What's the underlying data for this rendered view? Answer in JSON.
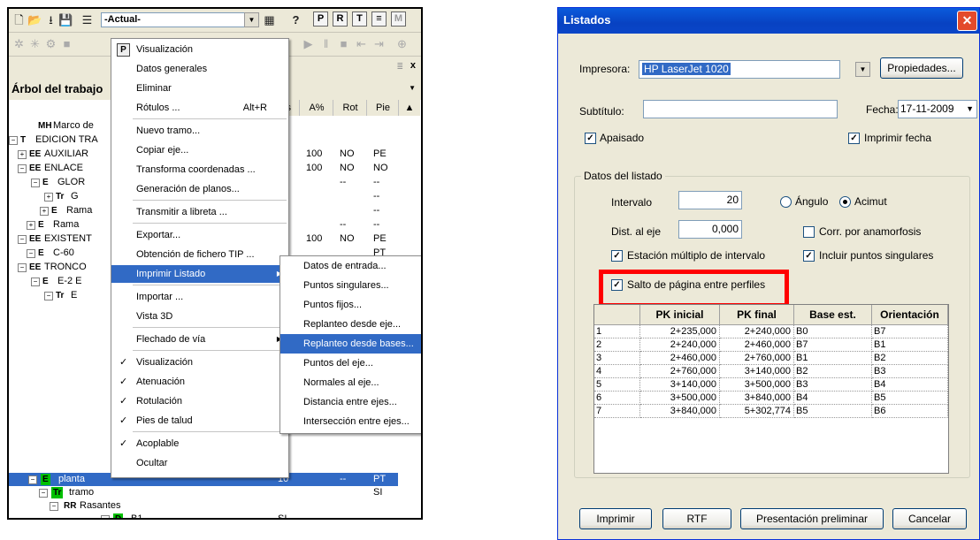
{
  "left": {
    "toolbar": {
      "view_combo": "-Actual-"
    },
    "tree_header": {
      "title": "Árbol del trabajo"
    },
    "columns": [
      "A%",
      "Rot",
      "Pie"
    ],
    "tree_rows": [
      {
        "code": "MH",
        "label": "Marco de",
        "a": "",
        "rot": "",
        "pie": ""
      },
      {
        "code": "T",
        "label": "EDICION TRA",
        "a": "",
        "rot": "",
        "pie": ""
      },
      {
        "code": "EE",
        "label": "AUXILIAR",
        "a": "100",
        "rot": "NO",
        "pie": "PE"
      },
      {
        "code": "EE",
        "label": "ENLACE",
        "a": "100",
        "rot": "NO",
        "pie": "NO"
      },
      {
        "code": "E",
        "label": "GLOR",
        "a": "",
        "rot": "--",
        "pie": "--"
      },
      {
        "code": "Tr",
        "label": "G",
        "a": "",
        "rot": "",
        "pie": "--"
      },
      {
        "code": "E",
        "label": "Rama",
        "a": "",
        "rot": "",
        "pie": "--"
      },
      {
        "code": "E",
        "label": "Rama",
        "a": "",
        "rot": "--",
        "pie": "--"
      },
      {
        "code": "EE",
        "label": "EXISTENT",
        "a": "100",
        "rot": "NO",
        "pie": "PE"
      },
      {
        "code": "E",
        "label": "C-60",
        "a": "",
        "rot": "",
        "pie": "PT"
      },
      {
        "code": "EE",
        "label": "TRONCO",
        "a": "",
        "rot": "",
        "pie": ""
      },
      {
        "code": "E",
        "label": "E-2 E",
        "a": "",
        "rot": "",
        "pie": ""
      },
      {
        "code": "Tr",
        "label": "E",
        "a": "",
        "rot": "",
        "pie": ""
      }
    ],
    "menu": [
      {
        "label": "Visualización",
        "icon": "P"
      },
      {
        "label": "Datos generales"
      },
      {
        "label": "Eliminar"
      },
      {
        "label": "Rótulos ...",
        "shortcut": "Alt+R"
      },
      {
        "label": "Nuevo tramo..."
      },
      {
        "label": "Copiar eje..."
      },
      {
        "label": "Transforma coordenadas ..."
      },
      {
        "label": "Generación de planos..."
      },
      {
        "label": "Transmitir a libreta ..."
      },
      {
        "label": "Exportar..."
      },
      {
        "label": "Obtención de fichero TIP ..."
      },
      {
        "label": "Imprimir Listado",
        "submenu": true,
        "highlighted": true
      },
      {
        "label": "Importar ..."
      },
      {
        "label": "Vista 3D"
      },
      {
        "label": "Flechado de vía",
        "submenu": true
      },
      {
        "label": "Visualización",
        "checked": true
      },
      {
        "label": "Atenuación",
        "checked": true
      },
      {
        "label": "Rotulación",
        "checked": true
      },
      {
        "label": "Pies de talud",
        "checked": true
      },
      {
        "label": "Acoplable",
        "checked": true
      },
      {
        "label": "Ocultar"
      }
    ],
    "submenu": [
      {
        "label": "Datos de entrada..."
      },
      {
        "label": "Puntos singulares..."
      },
      {
        "label": "Puntos fijos..."
      },
      {
        "label": "Replanteo desde eje..."
      },
      {
        "label": "Replanteo desde bases...",
        "highlighted": true
      },
      {
        "label": "Puntos del eje..."
      },
      {
        "label": "Normales al eje..."
      },
      {
        "label": "Distancia entre ejes..."
      },
      {
        "label": "Intersección entre ejes..."
      }
    ],
    "bottom_rows": [
      {
        "code": "E",
        "label": "planta",
        "col1": "10",
        "rot": "--",
        "pie": "PT",
        "selected": true
      },
      {
        "code": "Tr",
        "label": "tramo",
        "col1": "",
        "rot": "",
        "pie": "SI"
      },
      {
        "code": "RR",
        "label": "Rasantes",
        "col1": "",
        "rot": "",
        "pie": ""
      },
      {
        "code": "D",
        "label": "B1",
        "col1": "SI",
        "rot": "",
        "pie": ""
      }
    ]
  },
  "dialog": {
    "title": "Listados",
    "impresora_label": "Impresora:",
    "impresora_value": "HP LaserJet 1020",
    "propiedades": "Propiedades...",
    "subtitulo_label": "Subtítulo:",
    "fecha_label": "Fecha:",
    "fecha_value": "17-11-2009",
    "apaisado": "Apaisado",
    "imprimir_fecha": "Imprimir fecha",
    "group_title": "Datos del listado",
    "intervalo_label": "Intervalo",
    "intervalo_value": "20",
    "angulo": "Ángulo",
    "acimut": "Acimut",
    "dist_label": "Dist. al eje",
    "dist_value": "0,000",
    "corr": "Corr. por anamorfosis",
    "estacion": "Estación múltiplo de intervalo",
    "incluir": "Incluir puntos singulares",
    "salto": "Salto de página entre perfiles",
    "grid_headers": [
      "PK inicial",
      "PK final",
      "Base est.",
      "Orientación"
    ],
    "grid_rows": [
      {
        "n": "1",
        "pki": "2+235,000",
        "pkf": "2+240,000",
        "base": "B0",
        "ori": "B7"
      },
      {
        "n": "2",
        "pki": "2+240,000",
        "pkf": "2+460,000",
        "base": "B7",
        "ori": "B1"
      },
      {
        "n": "3",
        "pki": "2+460,000",
        "pkf": "2+760,000",
        "base": "B1",
        "ori": "B2"
      },
      {
        "n": "4",
        "pki": "2+760,000",
        "pkf": "3+140,000",
        "base": "B2",
        "ori": "B3"
      },
      {
        "n": "5",
        "pki": "3+140,000",
        "pkf": "3+500,000",
        "base": "B3",
        "ori": "B4"
      },
      {
        "n": "6",
        "pki": "3+500,000",
        "pkf": "3+840,000",
        "base": "B4",
        "ori": "B5"
      },
      {
        "n": "7",
        "pki": "3+840,000",
        "pkf": "5+302,774",
        "base": "B5",
        "ori": "B6"
      }
    ],
    "buttons": {
      "imprimir": "Imprimir",
      "rtf": "RTF",
      "preview": "Presentación preliminar",
      "cancelar": "Cancelar"
    }
  }
}
